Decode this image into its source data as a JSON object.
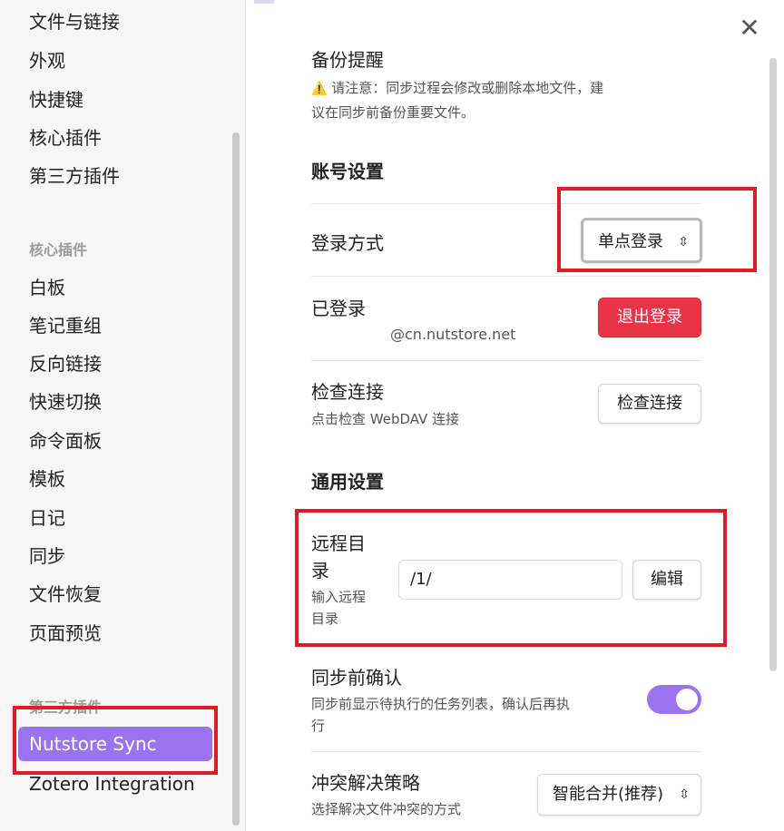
{
  "sidebar": {
    "top_items": [
      "文件与链接",
      "外观",
      "快捷键",
      "核心插件",
      "第三方插件"
    ],
    "core_header": "核心插件",
    "core_items": [
      "白板",
      "笔记重组",
      "反向链接",
      "快速切换",
      "命令面板",
      "模板",
      "日记",
      "同步",
      "文件恢复",
      "页面预览"
    ],
    "third_header": "第三方插件",
    "third_items": [
      "Nutstore Sync",
      "Zotero Integration"
    ]
  },
  "close_icon": "close-icon",
  "backup": {
    "title": "备份提醒",
    "warning_icon": "⚠️",
    "warning_line1": "请注意：同步过程会修改或删除本地文件，建",
    "warning_line2": "议在同步前备份重要文件。"
  },
  "account": {
    "section_title": "账号设置",
    "login_method_label": "登录方式",
    "login_method_value": "单点登录",
    "logged_in_label": "已登录",
    "logged_in_email": "@cn.nutstore.net",
    "logout_button": "退出登录",
    "check_label": "检查连接",
    "check_desc": "点击检查 WebDAV 连接",
    "check_button": "检查连接"
  },
  "general": {
    "section_title": "通用设置",
    "remote_dir_label_line1": "远程目",
    "remote_dir_label_line2": "录",
    "remote_dir_desc_line1": "输入远程",
    "remote_dir_desc_line2": "目录",
    "remote_dir_value": "/1/",
    "edit_button": "编辑",
    "confirm_label": "同步前确认",
    "confirm_desc_line1": "同步前显示待执行的任务列表，确认后再执",
    "confirm_desc_line2": "行",
    "confirm_toggle_on": true,
    "conflict_label": "冲突解决策略",
    "conflict_desc": "选择解决文件冲突的方式",
    "conflict_value": "智能合并(推荐)"
  },
  "colors": {
    "accent": "#9b72ef",
    "danger": "#e83446",
    "annotation_red": "#e01b24"
  }
}
